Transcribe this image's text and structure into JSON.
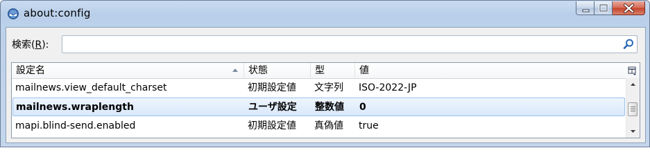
{
  "window": {
    "title": "about:config",
    "colors": {
      "close_button": "#c4432b",
      "selection_border": "#9cc3ee"
    }
  },
  "search": {
    "label_prefix": "検索(",
    "label_accel": "R",
    "label_suffix": "):",
    "value": "",
    "placeholder": ""
  },
  "table": {
    "columns": [
      "設定名",
      "状態",
      "型",
      "値"
    ],
    "sorted_column": "設定名",
    "rows": [
      {
        "name": "mailnews.view_default_charset",
        "status": "初期設定値",
        "type": "文字列",
        "value": "ISO-2022-JP",
        "selected": false
      },
      {
        "name": "mailnews.wraplength",
        "status": "ユーザ設定",
        "type": "整数値",
        "value": "0",
        "selected": true
      },
      {
        "name": "mapi.blind-send.enabled",
        "status": "初期設定値",
        "type": "真偽値",
        "value": "true",
        "selected": false
      }
    ]
  }
}
